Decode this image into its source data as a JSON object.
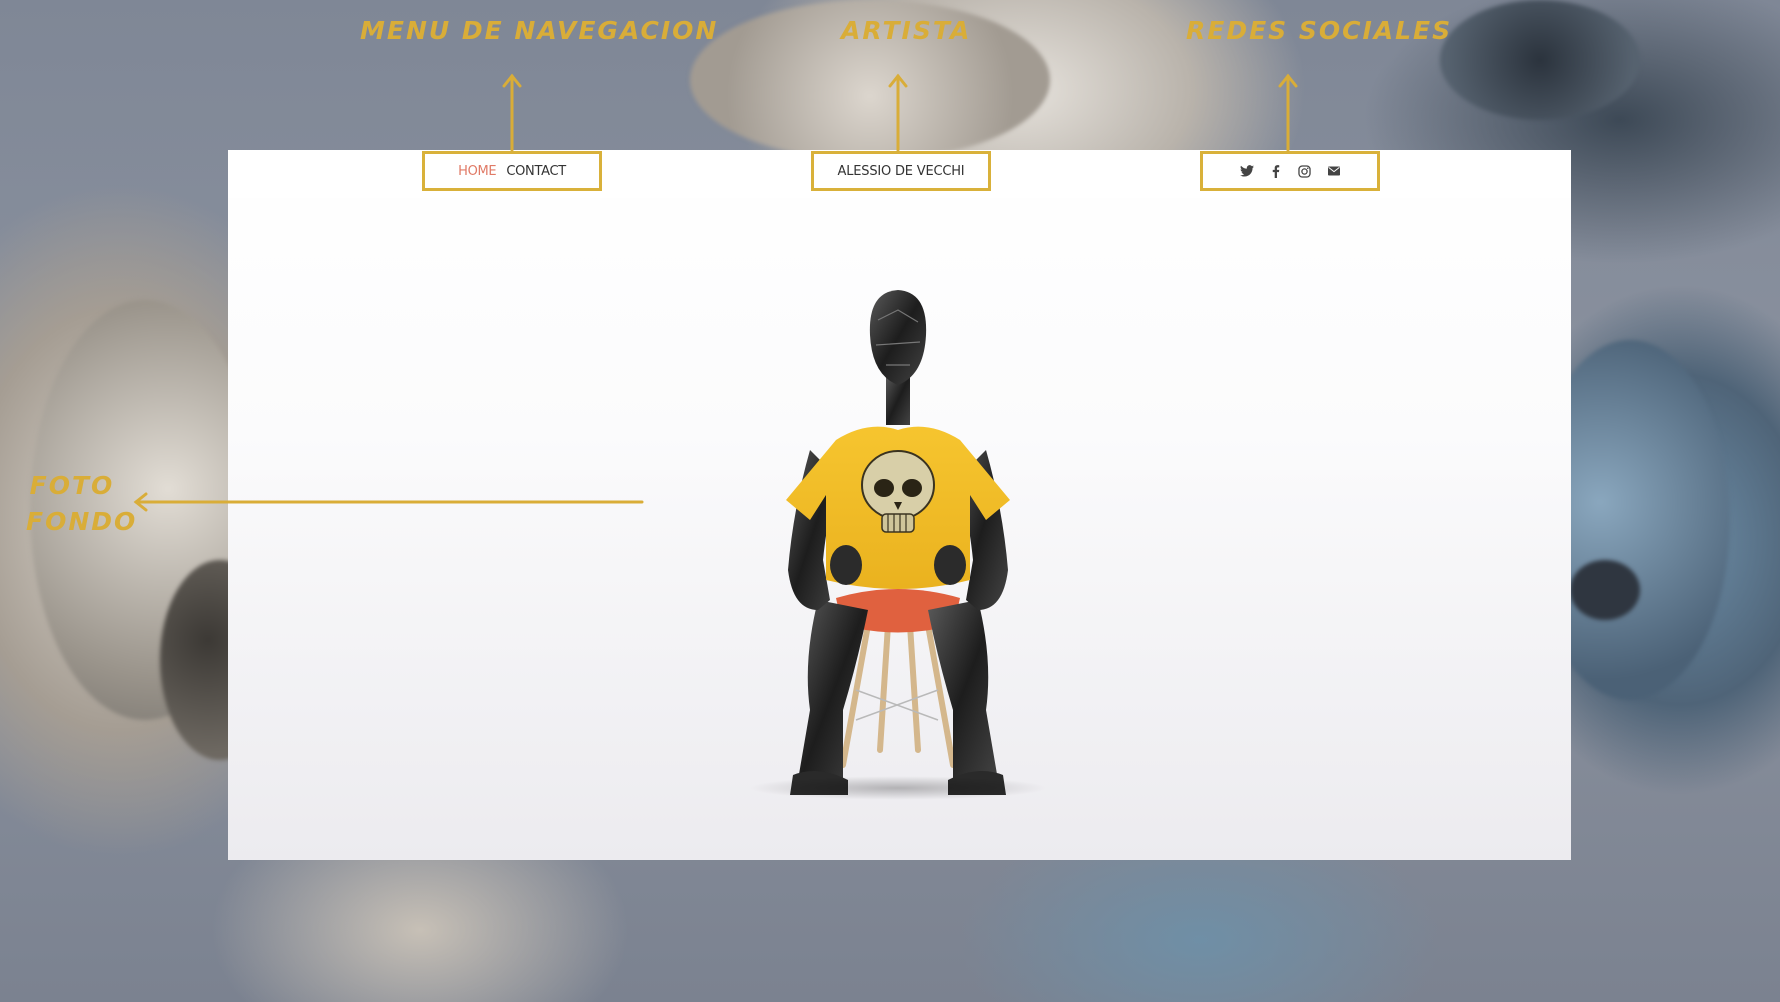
{
  "annotations": {
    "menu": "MENU DE NAVEGACION",
    "artist": "ARTISTA",
    "social": "REDES SOCIALES",
    "background_line1": "FOTO",
    "background_line2": "FONDO"
  },
  "site": {
    "nav": {
      "home_label": "HOME",
      "contact_label": "CONTACT"
    },
    "artist_name": "ALESSIO DE VECCHI",
    "social_icons": [
      "twitter-icon",
      "facebook-icon",
      "instagram-icon",
      "mail-icon"
    ]
  },
  "colors": {
    "annotation": "#d9ad38",
    "nav_active": "#e07a66",
    "shirt": "#f2c02c",
    "chair": "#e0613f"
  }
}
